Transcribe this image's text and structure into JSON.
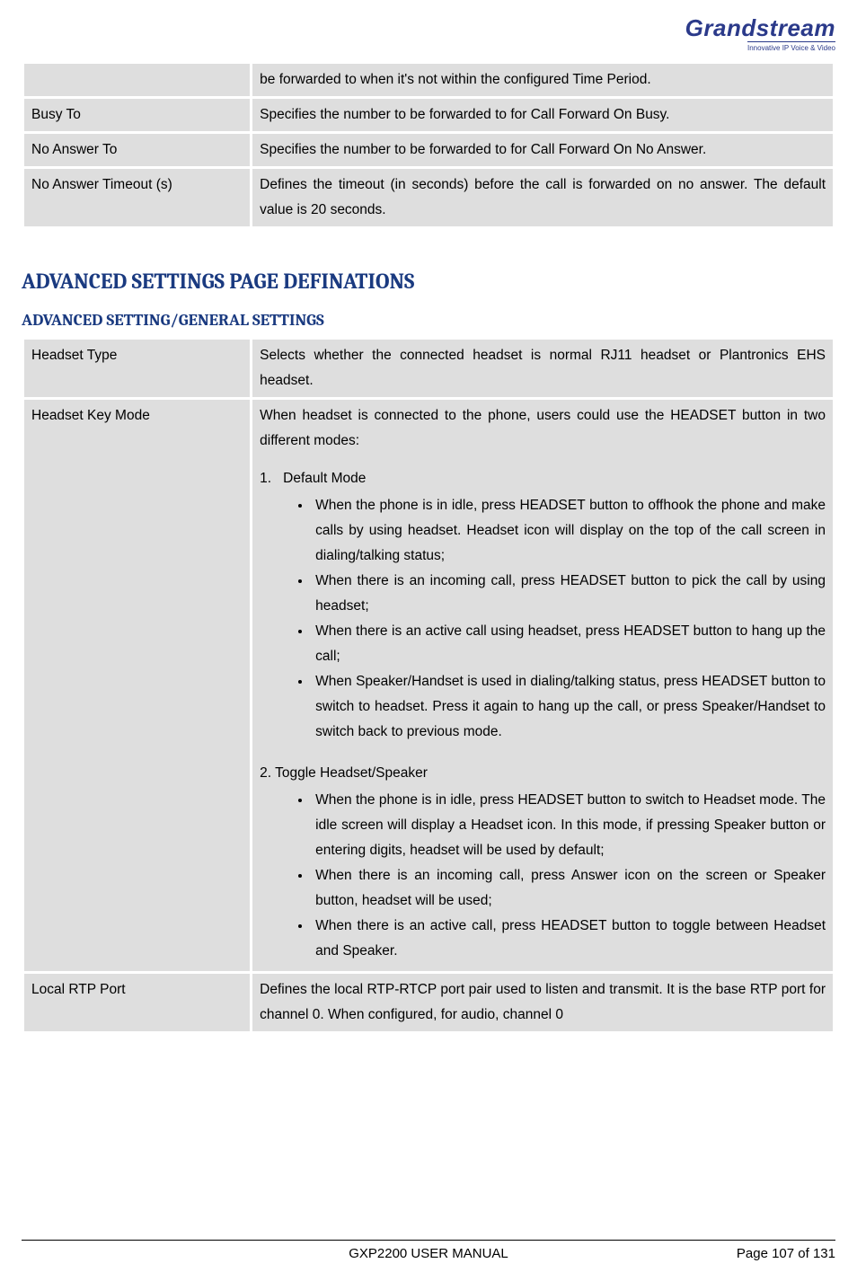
{
  "logo": {
    "brand": "Grandstream",
    "tagline": "Innovative IP Voice & Video"
  },
  "top_table": [
    {
      "label": "",
      "value": "be forwarded to when it's not within the configured Time Period."
    },
    {
      "label": "Busy To",
      "value": "Specifies the number to be forwarded to for Call Forward On Busy."
    },
    {
      "label": "No Answer To",
      "value": "Specifies the number to be forwarded to for Call Forward On No Answer."
    },
    {
      "label": "No Answer Timeout (s)",
      "value": "Defines the timeout (in seconds) before the call is forwarded on no answer. The default value is 20 seconds."
    }
  ],
  "section_heading": "ADVANCED SETTINGS PAGE DEFINATIONS",
  "subsection_heading": "ADVANCED SETTING/GENERAL SETTINGS",
  "adv_table": {
    "row1": {
      "label": "Headset Type",
      "value": "Selects whether the connected headset is normal RJ11 headset or Plantronics EHS headset."
    },
    "row2": {
      "label": "Headset Key Mode",
      "intro": "When headset is connected to the phone, users could use the HEADSET button in two different modes:",
      "mode1_num": "1.",
      "mode1_title": "Default Mode",
      "mode1_bullets": [
        "When the phone is in idle, press HEADSET button to offhook the phone and make calls by using headset. Headset icon will display on the top of the call screen in dialing/talking status;",
        "When there is an incoming call, press HEADSET button to pick the call by using headset;",
        "When there is an active call using headset, press HEADSET button to hang up the call;",
        "When Speaker/Handset is used in dialing/talking status, press HEADSET button to switch to headset. Press it again to hang up the call, or press Speaker/Handset to switch back to previous mode."
      ],
      "mode2_title": "2. Toggle Headset/Speaker",
      "mode2_bullets": [
        "When the phone is in idle, press HEADSET button to switch to Headset mode. The idle screen will display a Headset icon. In this mode, if pressing Speaker button or entering digits, headset will be used by default;",
        "When there is an incoming call, press Answer icon on the screen or Speaker button, headset will be used;",
        "When there is an active call, press HEADSET button to toggle between Headset and Speaker."
      ]
    },
    "row3": {
      "label": "Local RTP Port",
      "value": "Defines the local RTP-RTCP port pair used to listen and transmit. It is the base RTP port for channel 0. When configured, for audio, channel 0"
    }
  },
  "footer": {
    "center": "GXP2200 USER MANUAL",
    "right": "Page 107 of 131"
  }
}
